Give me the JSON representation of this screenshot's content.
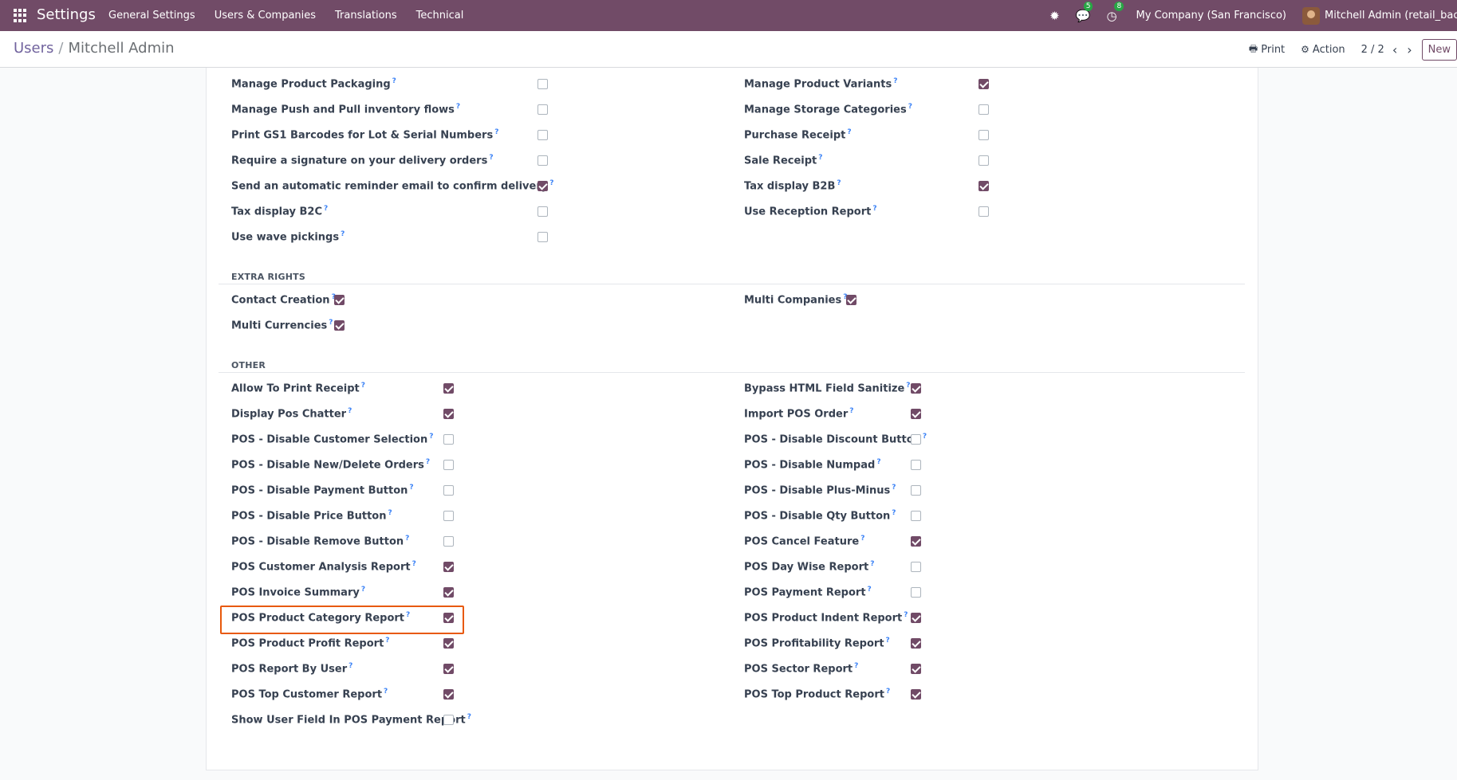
{
  "navbar": {
    "app_name": "Settings",
    "menu": [
      "General Settings",
      "Users & Companies",
      "Translations",
      "Technical"
    ],
    "messages_count": "5",
    "activities_count": "8",
    "company": "My Company (San Francisco)",
    "user": "Mitchell Admin (retail_backu"
  },
  "control": {
    "breadcrumb_parent": "Users",
    "breadcrumb_sep": "/",
    "breadcrumb_current": "Mitchell Admin",
    "print_label": "Print",
    "action_label": "Action",
    "pager": "2 / 2",
    "new_label": "New"
  },
  "top_rows": [
    {
      "left": {
        "label": "Manage Product Packaging",
        "checked": false
      },
      "right": {
        "label": "Manage Product Variants",
        "checked": true
      }
    },
    {
      "left": {
        "label": "Manage Push and Pull inventory flows",
        "checked": false
      },
      "right": {
        "label": "Manage Storage Categories",
        "checked": false
      }
    },
    {
      "left": {
        "label": "Print GS1 Barcodes for Lot & Serial Numbers",
        "checked": false
      },
      "right": {
        "label": "Purchase Receipt",
        "checked": false
      }
    },
    {
      "left": {
        "label": "Require a signature on your delivery orders",
        "checked": false
      },
      "right": {
        "label": "Sale Receipt",
        "checked": false
      }
    },
    {
      "left": {
        "label": "Send an automatic reminder email to confirm delivery",
        "checked": true
      },
      "right": {
        "label": "Tax display B2B",
        "checked": true
      }
    },
    {
      "left": {
        "label": "Tax display B2C",
        "checked": false
      },
      "right": {
        "label": "Use Reception Report",
        "checked": false
      }
    },
    {
      "left": {
        "label": "Use wave pickings",
        "checked": false
      },
      "right": null
    }
  ],
  "extra_rights": {
    "title": "EXTRA RIGHTS",
    "rows": [
      {
        "left": {
          "label": "Contact Creation",
          "checked": true
        },
        "right": {
          "label": "Multi Companies",
          "checked": true
        }
      },
      {
        "left": {
          "label": "Multi Currencies",
          "checked": true
        },
        "right": null
      }
    ]
  },
  "other": {
    "title": "OTHER",
    "rows": [
      {
        "left": {
          "label": "Allow To Print Receipt",
          "checked": true
        },
        "right": {
          "label": "Bypass HTML Field Sanitize",
          "checked": true
        }
      },
      {
        "left": {
          "label": "Display Pos Chatter",
          "checked": true
        },
        "right": {
          "label": "Import POS Order",
          "checked": true
        }
      },
      {
        "left": {
          "label": "POS - Disable Customer Selection",
          "checked": false
        },
        "right": {
          "label": "POS - Disable Discount Button",
          "checked": false
        }
      },
      {
        "left": {
          "label": "POS - Disable New/Delete Orders",
          "checked": false
        },
        "right": {
          "label": "POS - Disable Numpad",
          "checked": false
        }
      },
      {
        "left": {
          "label": "POS - Disable Payment Button",
          "checked": false
        },
        "right": {
          "label": "POS - Disable Plus-Minus",
          "checked": false
        }
      },
      {
        "left": {
          "label": "POS - Disable Price Button",
          "checked": false
        },
        "right": {
          "label": "POS - Disable Qty Button",
          "checked": false
        }
      },
      {
        "left": {
          "label": "POS - Disable Remove Button",
          "checked": false
        },
        "right": {
          "label": "POS Cancel Feature",
          "checked": true
        }
      },
      {
        "left": {
          "label": "POS Customer Analysis Report",
          "checked": true
        },
        "right": {
          "label": "POS Day Wise Report",
          "checked": false
        }
      },
      {
        "left": {
          "label": "POS Invoice Summary",
          "checked": true
        },
        "right": {
          "label": "POS Payment Report",
          "checked": false
        }
      },
      {
        "left": {
          "label": "POS Product Category Report",
          "checked": true
        },
        "right": {
          "label": "POS Product Indent Report",
          "checked": true
        }
      },
      {
        "left": {
          "label": "POS Product Profit Report",
          "checked": true
        },
        "right": {
          "label": "POS Profitability Report",
          "checked": true
        }
      },
      {
        "left": {
          "label": "POS Report By User",
          "checked": true
        },
        "right": {
          "label": "POS Sector Report",
          "checked": true
        }
      },
      {
        "left": {
          "label": "POS Top Customer Report",
          "checked": true
        },
        "right": {
          "label": "POS Top Product Report",
          "checked": true
        }
      },
      {
        "left": {
          "label": "Show User Field In POS Payment Report",
          "checked": false
        },
        "right": null
      }
    ]
  },
  "help_mark": "?",
  "colors": {
    "brand": "#714b67",
    "highlight": "#e8590c"
  }
}
